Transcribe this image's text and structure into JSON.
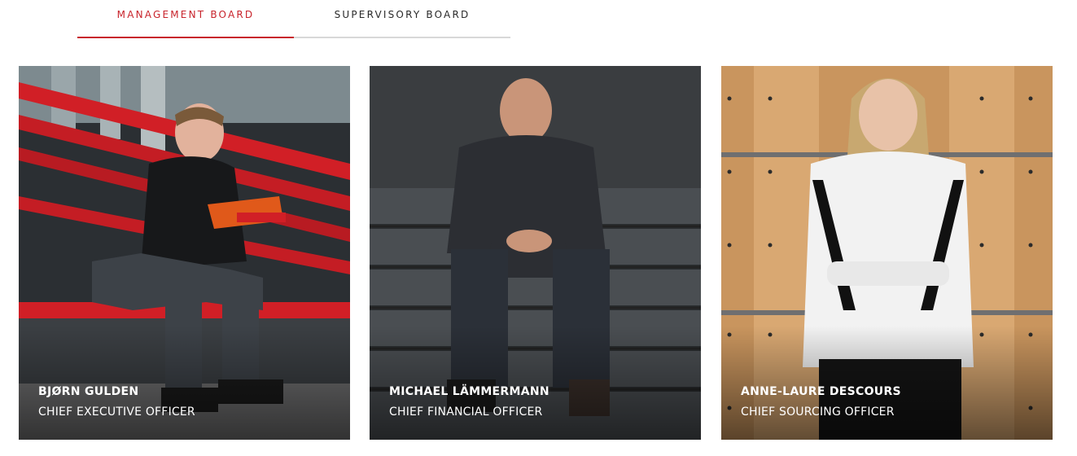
{
  "tabs": [
    {
      "label": "MANAGEMENT BOARD",
      "active": true
    },
    {
      "label": "SUPERVISORY BOARD",
      "active": false
    }
  ],
  "members": [
    {
      "name": "BJØRN GULDEN",
      "role": "CHIEF EXECUTIVE OFFICER"
    },
    {
      "name": "MICHAEL LÄMMERMANN",
      "role": "CHIEF FINANCIAL OFFICER"
    },
    {
      "name": "ANNE-LAURE DESCOURS",
      "role": "CHIEF SOURCING OFFICER"
    }
  ],
  "colors": {
    "accent": "#c8242c",
    "inactive_underline": "#d8d8d8",
    "text_dark": "#2a2a2a"
  }
}
